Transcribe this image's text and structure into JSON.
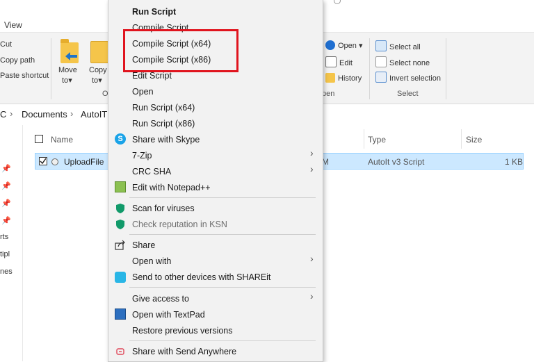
{
  "ribbon": {
    "tab_view": "View",
    "cut": "Cut",
    "copy_path": "Copy path",
    "paste_shortcut": "Paste shortcut",
    "move_to": "Move",
    "move_to_sub": "to",
    "copy_to": "Copy",
    "copy_to_sub": "to",
    "organize_partial": "O",
    "open": "Open",
    "edit": "Edit",
    "history": "History",
    "open_group_partial": "pen",
    "select_all": "Select all",
    "select_none": "Select none",
    "invert_selection": "Invert selection",
    "select_group": "Select"
  },
  "address": {
    "crumb_pc": "C",
    "crumb_documents": "Documents",
    "crumb_autoit": "AutoIT"
  },
  "columns": {
    "name": "Name",
    "type": "Type",
    "size": "Size"
  },
  "nav_partial": [
    "rts",
    "tipl",
    "nes"
  ],
  "file": {
    "name": "UploadFile",
    "date_partial": "M",
    "type": "AutoIt v3 Script",
    "size": "1 KB"
  },
  "menu": {
    "run_script": "Run Script",
    "compile_script": "Compile Script",
    "compile_x64": "Compile Script (x64)",
    "compile_x86": "Compile Script (x86)",
    "edit_script": "Edit Script",
    "open": "Open",
    "run_x64": "Run Script (x64)",
    "run_x86": "Run Script (x86)",
    "share_skype": "Share with Skype",
    "seven_zip": "7-Zip",
    "crc_sha": "CRC SHA",
    "edit_notepad": "Edit with Notepad++",
    "scan_viruses": "Scan for viruses",
    "check_ksn": "Check reputation in KSN",
    "share": "Share",
    "open_with": "Open with",
    "send_shareit": "Send to other devices with SHAREit",
    "give_access": "Give access to",
    "open_textpad": "Open with TextPad",
    "restore_versions": "Restore previous versions",
    "send_anywhere": "Share with Send Anywhere"
  },
  "colors": {
    "highlight": "#e0141e",
    "selection": "#cce8ff",
    "menu_bg": "#f2f2f2"
  }
}
